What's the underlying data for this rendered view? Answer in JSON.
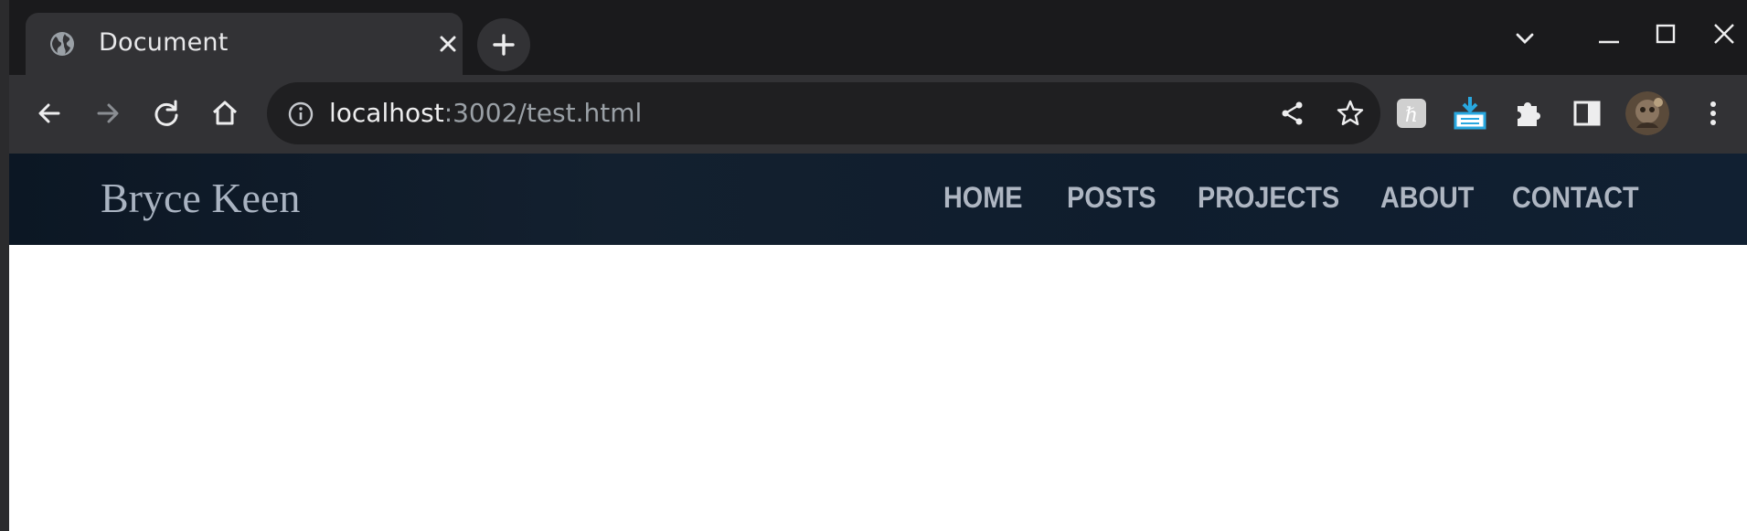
{
  "browser": {
    "tab": {
      "title": "Document",
      "favicon": "globe-icon"
    },
    "new_tab_icon": "plus-icon",
    "window_controls": [
      "tab-search-chevron",
      "minimize",
      "maximize",
      "close"
    ],
    "omnibox": {
      "host": "localhost",
      "path": ":3002/test.html"
    },
    "toolbar_icons": [
      "back-arrow",
      "forward-arrow",
      "reload",
      "home",
      "info",
      "share",
      "star",
      "extension-h",
      "extension-download",
      "extensions-puzzle",
      "side-panel",
      "profile-avatar",
      "menu-dots"
    ],
    "colors": {
      "tabstrip": "#1a1a1c",
      "toolbar": "#323235",
      "omnibox": "#1f1f21"
    }
  },
  "site": {
    "title": "Bryce Keen",
    "nav": {
      "home": "HOME",
      "posts": "POSTS",
      "projects": "PROJECTS",
      "about": "ABOUT",
      "contact": "CONTACT"
    },
    "colors": {
      "header_bg": "#0f1d2d",
      "text": "#aeb6c2"
    }
  }
}
